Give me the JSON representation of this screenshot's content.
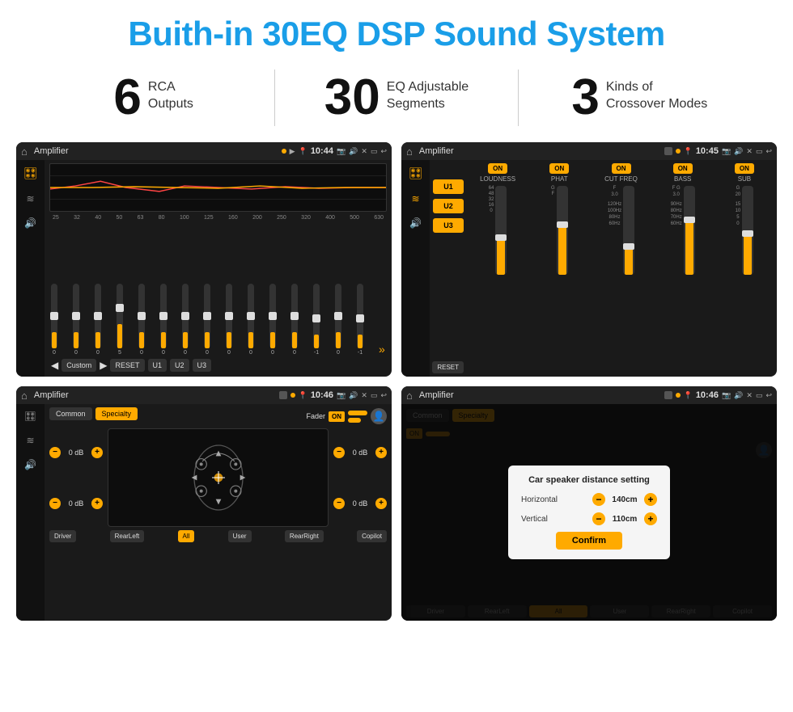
{
  "page": {
    "title": "Buith-in 30EQ DSP Sound System",
    "stats": [
      {
        "number": "6",
        "label": "RCA\nOutputs"
      },
      {
        "number": "30",
        "label": "EQ Adjustable\nSegments"
      },
      {
        "number": "3",
        "label": "Kinds of\nCrossover Modes"
      }
    ]
  },
  "screens": {
    "eq": {
      "title": "Amplifier",
      "time": "10:44",
      "freqs": [
        "25",
        "32",
        "40",
        "50",
        "63",
        "80",
        "100",
        "125",
        "160",
        "200",
        "250",
        "320",
        "400",
        "500",
        "630"
      ],
      "sliders": [
        "0",
        "0",
        "0",
        "5",
        "0",
        "0",
        "0",
        "0",
        "0",
        "0",
        "0",
        "0",
        "-1",
        "0",
        "-1"
      ],
      "buttons": [
        "Custom",
        "RESET",
        "U1",
        "U2",
        "U3"
      ]
    },
    "crossover": {
      "title": "Amplifier",
      "time": "10:45",
      "presets": [
        "U1",
        "U2",
        "U3"
      ],
      "controls": [
        {
          "label": "LOUDNESS",
          "on": true
        },
        {
          "label": "PHAT",
          "on": true
        },
        {
          "label": "CUT FREQ",
          "on": true
        },
        {
          "label": "BASS",
          "on": true
        },
        {
          "label": "SUB",
          "on": true
        }
      ]
    },
    "fader": {
      "title": "Amplifier",
      "time": "10:46",
      "tabs": [
        "Common",
        "Specialty"
      ],
      "fader_label": "Fader",
      "on_label": "ON",
      "db_values": [
        "0 dB",
        "0 dB",
        "0 dB",
        "0 dB"
      ],
      "bottom_btns": [
        "Driver",
        "RearLeft",
        "All",
        "User",
        "RearRight",
        "Copilot"
      ]
    },
    "dialog": {
      "title": "Amplifier",
      "time": "10:46",
      "dialog_title": "Car speaker distance setting",
      "horizontal_label": "Horizontal",
      "horizontal_value": "140cm",
      "vertical_label": "Vertical",
      "vertical_value": "110cm",
      "confirm_label": "Confirm",
      "bottom_btns": [
        "Driver",
        "RearLeft",
        "All",
        "User",
        "RearRight",
        "Copilot"
      ]
    }
  },
  "icons": {
    "home": "⌂",
    "settings": "≡",
    "sound_wave": "≋",
    "speaker": "🔊",
    "person": "👤",
    "arrow_left": "◀",
    "arrow_right": "▶",
    "arrow_up": "▲",
    "arrow_down": "▼",
    "location": "📍",
    "minus": "−",
    "plus": "+"
  }
}
